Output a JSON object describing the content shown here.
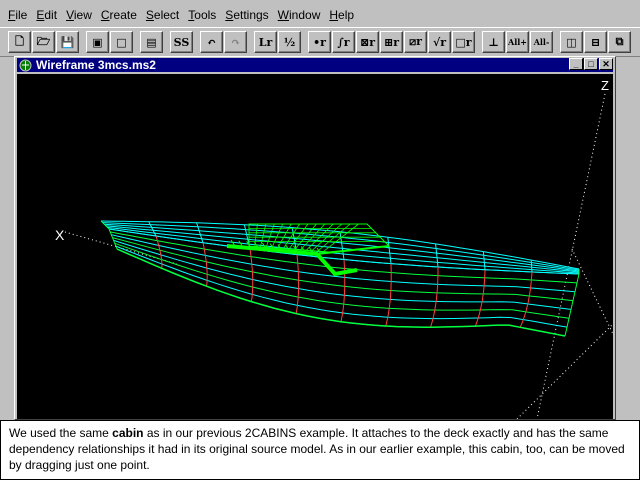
{
  "menu": [
    {
      "label": "File",
      "accel": "F",
      "rest": "ile"
    },
    {
      "label": "Edit",
      "accel": "E",
      "rest": "dit"
    },
    {
      "label": "View",
      "accel": "V",
      "rest": "iew"
    },
    {
      "label": "Create",
      "accel": "C",
      "rest": "reate"
    },
    {
      "label": "Select",
      "accel": "S",
      "rest": "elect"
    },
    {
      "label": "Tools",
      "accel": "T",
      "rest": "ools"
    },
    {
      "label": "Settings",
      "accel": "S",
      "rest": "ettings"
    },
    {
      "label": "Window",
      "accel": "W",
      "rest": "indow"
    },
    {
      "label": "Help",
      "accel": "H",
      "rest": "elp"
    }
  ],
  "toolbar": {
    "buttons": [
      {
        "name": "new-icon",
        "glyph": "🗋"
      },
      {
        "name": "open-icon",
        "glyph": "🗁"
      },
      {
        "name": "save-icon",
        "glyph": "💾"
      },
      {
        "name": "gap"
      },
      {
        "name": "frame-icon",
        "glyph": "▣"
      },
      {
        "name": "square-icon",
        "glyph": "□"
      },
      {
        "name": "gap"
      },
      {
        "name": "panel-icon",
        "glyph": "▤"
      },
      {
        "name": "gap"
      },
      {
        "name": "ss-icon",
        "glyph": "SS"
      },
      {
        "name": "gap"
      },
      {
        "name": "undo-icon",
        "glyph": "↶"
      },
      {
        "name": "redo-icon",
        "glyph": "↷",
        "disabled": true
      },
      {
        "name": "gap"
      },
      {
        "name": "length-icon",
        "glyph": "Lr"
      },
      {
        "name": "fraction-icon",
        "glyph": "½"
      },
      {
        "name": "gap"
      },
      {
        "name": "point-icon",
        "glyph": "•r"
      },
      {
        "name": "curve-icon",
        "glyph": "∫r"
      },
      {
        "name": "snake-icon",
        "glyph": "⊠r"
      },
      {
        "name": "grid-icon",
        "glyph": "⊞r"
      },
      {
        "name": "slash-icon",
        "glyph": "⧄r"
      },
      {
        "name": "check-icon",
        "glyph": "√r"
      },
      {
        "name": "box-icon",
        "glyph": "□r"
      },
      {
        "name": "gap"
      },
      {
        "name": "axis-icon",
        "glyph": "⊥"
      },
      {
        "name": "all-plus-icon",
        "glyph": "All+"
      },
      {
        "name": "all-minus-icon",
        "glyph": "All-"
      },
      {
        "name": "gap"
      },
      {
        "name": "tile-v-icon",
        "glyph": "◫"
      },
      {
        "name": "tile-h-icon",
        "glyph": "⊟"
      },
      {
        "name": "cascade-icon",
        "glyph": "⧉"
      }
    ]
  },
  "doc_window": {
    "title": "Wireframe 3mcs.ms2",
    "min": "_",
    "max": "□",
    "close": "✕"
  },
  "viewport": {
    "axis_z_label": "Z",
    "axis_x_label": "X",
    "hull_color": "#00ff40",
    "station_color": "#ff4040",
    "waterline_color": "#00ffff",
    "cabin_color": "#00ff00",
    "axis_color": "#ffffff"
  },
  "caption": {
    "part1": "We used the same ",
    "bold": "cabin",
    "part2": " as in our previous 2CABINS example. It attaches to the deck exactly and has the same dependency relationships it had in its original source model. As in our earlier example, this cabin, too, can be moved by dragging just one point."
  }
}
